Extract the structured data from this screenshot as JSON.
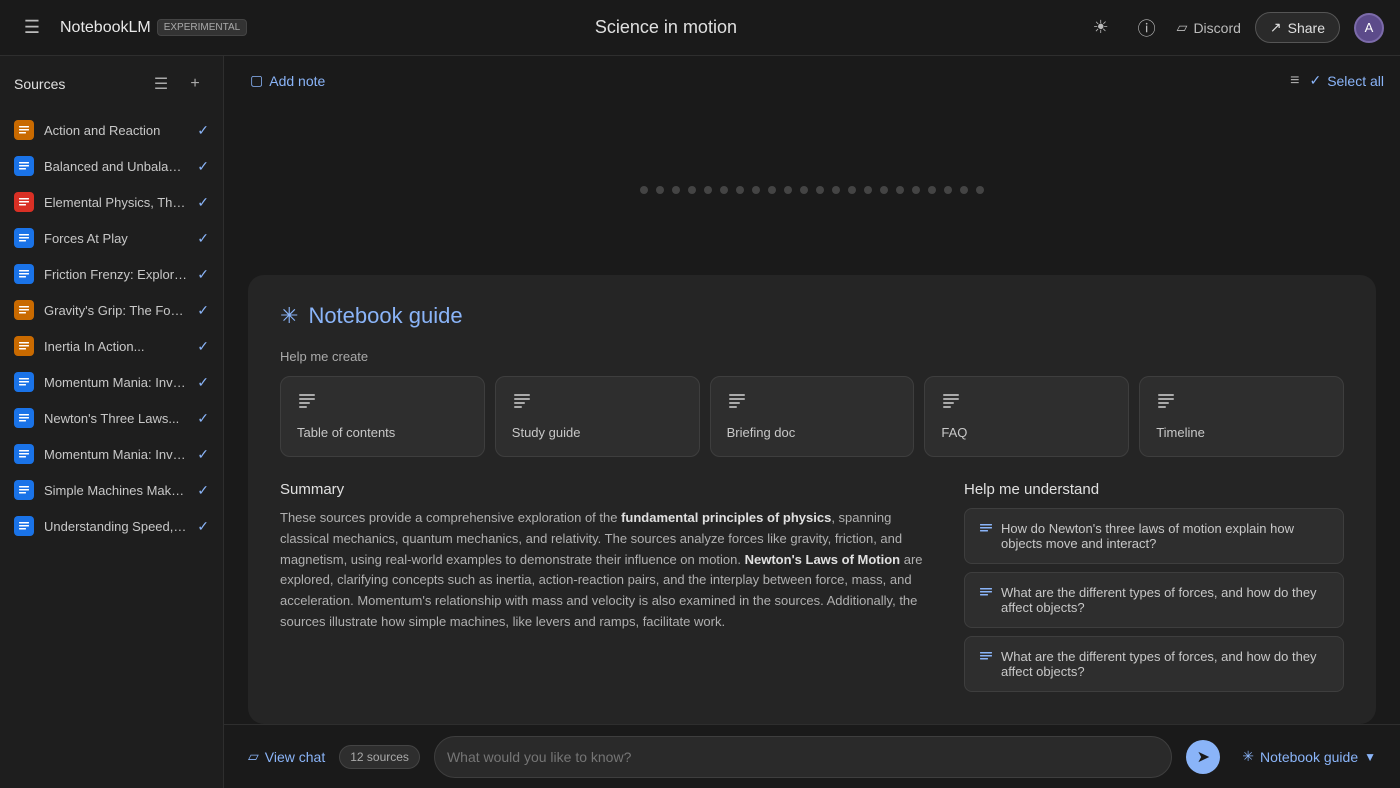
{
  "app": {
    "brand_name": "NotebookLM",
    "brand_badge": "EXPERIMENTAL",
    "page_title": "Science in motion",
    "discord_label": "Discord",
    "share_label": "Share",
    "avatar_initial": "A"
  },
  "sidebar": {
    "title": "Sources",
    "select_all_label": "Select all",
    "sources": [
      {
        "id": 1,
        "label": "Action and Reaction",
        "icon_type": "orange",
        "icon_char": "☰",
        "checked": true
      },
      {
        "id": 2,
        "label": "Balanced and Unbalance...",
        "icon_type": "blue",
        "icon_char": "☰",
        "checked": true
      },
      {
        "id": 3,
        "label": "Elemental Physics, Third...",
        "icon_type": "red",
        "icon_char": "☰",
        "checked": true
      },
      {
        "id": 4,
        "label": "Forces At Play",
        "icon_type": "blue",
        "icon_char": "☰",
        "checked": true
      },
      {
        "id": 5,
        "label": "Friction Frenzy: Explorin...",
        "icon_type": "blue",
        "icon_char": "☰",
        "checked": true
      },
      {
        "id": 6,
        "label": "Gravity's Grip: The Force...",
        "icon_type": "orange",
        "icon_char": "☰",
        "checked": true
      },
      {
        "id": 7,
        "label": "Inertia In Action...",
        "icon_type": "orange",
        "icon_char": "☰",
        "checked": true
      },
      {
        "id": 8,
        "label": "Momentum Mania: Inves...",
        "icon_type": "blue",
        "icon_char": "☰",
        "checked": true
      },
      {
        "id": 9,
        "label": "Newton's Three Laws...",
        "icon_type": "blue",
        "icon_char": "☰",
        "checked": true
      },
      {
        "id": 10,
        "label": "Momentum Mania: Inves...",
        "icon_type": "blue",
        "icon_char": "☰",
        "checked": true
      },
      {
        "id": 11,
        "label": "Simple Machines Make...",
        "icon_type": "blue",
        "icon_char": "☰",
        "checked": true
      },
      {
        "id": 12,
        "label": "Understanding Speed, Ve...",
        "icon_type": "blue",
        "icon_char": "☰",
        "checked": true
      }
    ]
  },
  "toolbar": {
    "add_note_label": "Add note",
    "select_all_label": "Select all"
  },
  "notebook_guide": {
    "title": "Notebook guide",
    "help_create_label": "Help me create",
    "cards": [
      {
        "id": "table-of-contents",
        "label": "Table of\ncontents",
        "icon": "⊟"
      },
      {
        "id": "study-guide",
        "label": "Study\nguide",
        "icon": "⊟"
      },
      {
        "id": "briefing-doc",
        "label": "Briefing\ndoc",
        "icon": "⊟"
      },
      {
        "id": "faq",
        "label": "FAQ",
        "icon": "⊟"
      },
      {
        "id": "timeline",
        "label": "Timeline",
        "icon": "⊟"
      }
    ],
    "summary_title": "Summary",
    "summary_text": "These sources provide a comprehensive exploration of the fundamental principles of physics, spanning classical mechanics, quantum mechanics, and relativity. The sources analyze forces like gravity, friction, and magnetism, using real-world examples to demonstrate their influence on motion. Newton's Laws of Motion are explored, clarifying concepts such as inertia, action-reaction pairs, and the interplay between force, mass, and acceleration. Momentum's relationship with mass and velocity is also examined in the sources. Additionally, the sources illustrate how simple machines, like levers and ramps, facilitate work.",
    "summary_bold_phrases": [
      "fundamental principles of physics",
      "Newton's Laws of Motion"
    ],
    "understand_title": "Help me understand",
    "understand_questions": [
      "How do Newton's three laws of motion explain how objects move and interact?",
      "What are the different types of forces, and how do they affect objects?",
      "What are the different types of forces, and how do they affect objects?"
    ]
  },
  "chat_bar": {
    "view_chat_label": "View chat",
    "sources_count": "12 sources",
    "input_placeholder": "What would you like to know?",
    "notebook_guide_label": "Notebook guide"
  }
}
